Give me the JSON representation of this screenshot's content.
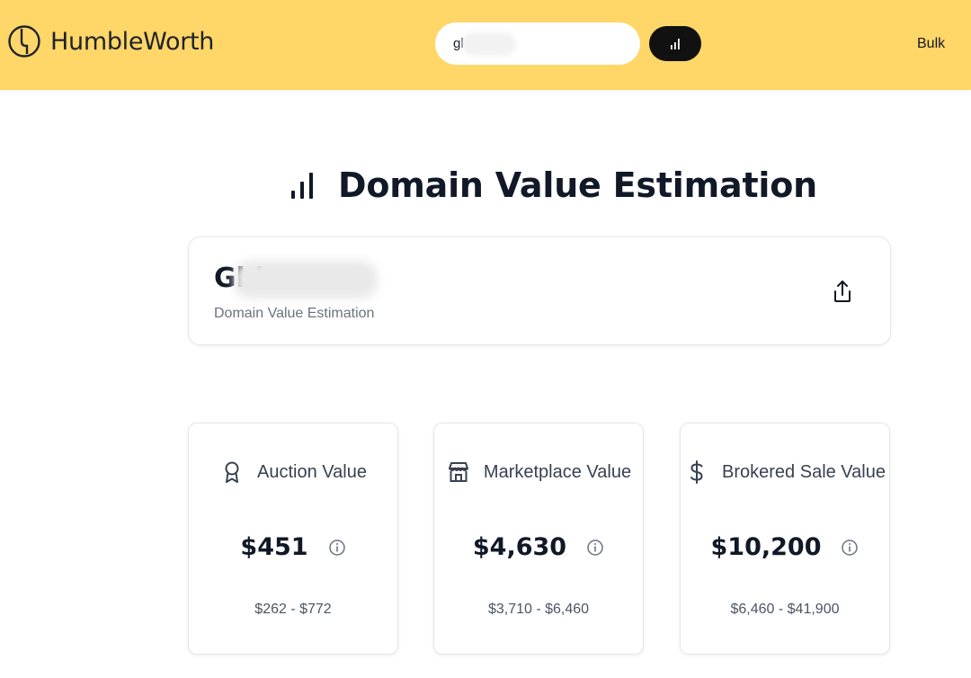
{
  "header": {
    "brand": "HumbleWorth",
    "search_value": "gl      k",
    "bulk_label": "Bulk",
    "accent_color": "#ffd668",
    "icons": {
      "logo": "humbleworth-logo-icon",
      "search_button": "bar-chart-icon"
    }
  },
  "main": {
    "title": "Domain Value Estimation",
    "title_icon": "bar-chart-icon",
    "domain_card": {
      "domain": "Gl      k",
      "subtitle": "Domain Value Estimation",
      "share_icon": "share-icon"
    },
    "cards": [
      {
        "label": "Auction Value",
        "icon": "award-ribbon-icon",
        "value": "$451",
        "range": "$262 - $772"
      },
      {
        "label": "Marketplace Value",
        "icon": "store-icon",
        "value": "$4,630",
        "range": "$3,710 - $6,460"
      },
      {
        "label": "Brokered Sale Value",
        "icon": "dollar-sign-icon",
        "value": "$10,200",
        "range": "$6,460 - $41,900"
      }
    ]
  }
}
